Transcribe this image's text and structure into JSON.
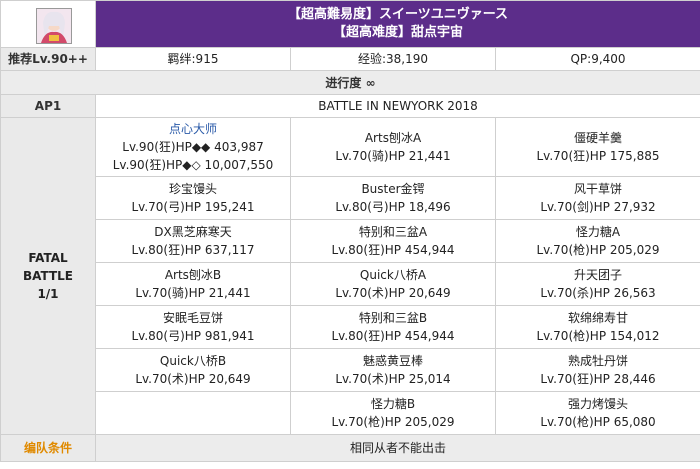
{
  "header": {
    "title_jp": "【超高難易度】スイーツユニヴァース",
    "title_cn": "【超高难度】甜点宇宙",
    "avatar_icon": "servant-avatar-icon"
  },
  "stats": {
    "recommend": "推荐Lv.90++",
    "bond": "羁绊:915",
    "exp": "经验:38,190",
    "qp": "QP:9,400"
  },
  "progress": "进行度 ∞",
  "ap": {
    "label": "AP1",
    "value": "BATTLE IN NEWYORK 2018"
  },
  "battle": {
    "label_line1": "FATAL",
    "label_line2": "BATTLE",
    "label_line3": "1/1",
    "rows": [
      [
        {
          "name": "点心大师",
          "stats": [
            "Lv.90(狂)HP◆◆ 403,987",
            "Lv.90(狂)HP◆◇ 10,007,550"
          ],
          "boss": true
        },
        {
          "name": "Arts刨冰A",
          "stats": [
            "Lv.70(骑)HP 21,441"
          ]
        },
        {
          "name": "僵硬羊羹",
          "stats": [
            "Lv.70(狂)HP 175,885"
          ]
        }
      ],
      [
        {
          "name": "珍宝馒头",
          "stats": [
            "Lv.70(弓)HP 195,241"
          ]
        },
        {
          "name": "Buster金锷",
          "stats": [
            "Lv.80(弓)HP 18,496"
          ]
        },
        {
          "name": "风干草饼",
          "stats": [
            "Lv.70(剑)HP 27,932"
          ]
        }
      ],
      [
        {
          "name": "DX黑芝麻寒天",
          "stats": [
            "Lv.80(狂)HP 637,117"
          ]
        },
        {
          "name": "特别和三盆A",
          "stats": [
            "Lv.80(狂)HP 454,944"
          ]
        },
        {
          "name": "怪力糖A",
          "stats": [
            "Lv.70(枪)HP 205,029"
          ]
        }
      ],
      [
        {
          "name": "Arts刨冰B",
          "stats": [
            "Lv.70(骑)HP 21,441"
          ]
        },
        {
          "name": "Quick八桥A",
          "stats": [
            "Lv.70(术)HP 20,649"
          ]
        },
        {
          "name": "升天团子",
          "stats": [
            "Lv.70(杀)HP 26,563"
          ]
        }
      ],
      [
        {
          "name": "安眠毛豆饼",
          "stats": [
            "Lv.80(弓)HP 981,941"
          ]
        },
        {
          "name": "特别和三盆B",
          "stats": [
            "Lv.80(狂)HP 454,944"
          ]
        },
        {
          "name": "软绵绵寿甘",
          "stats": [
            "Lv.70(枪)HP 154,012"
          ]
        }
      ],
      [
        {
          "name": "Quick八桥B",
          "stats": [
            "Lv.70(术)HP 20,649"
          ]
        },
        {
          "name": "魅惑黄豆棒",
          "stats": [
            "Lv.70(术)HP 25,014"
          ]
        },
        {
          "name": "熟成牡丹饼",
          "stats": [
            "Lv.70(狂)HP 28,446"
          ]
        }
      ],
      [
        {
          "name": "",
          "stats": []
        },
        {
          "name": "怪力糖B",
          "stats": [
            "Lv.70(枪)HP 205,029"
          ]
        },
        {
          "name": "强力烤馒头",
          "stats": [
            "Lv.70(枪)HP 65,080"
          ]
        }
      ]
    ]
  },
  "condition": {
    "label": "编队条件",
    "value": "相同从者不能出击"
  }
}
